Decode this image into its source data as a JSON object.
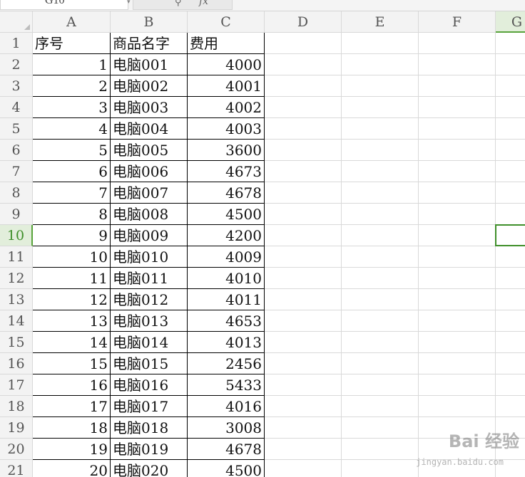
{
  "formula_bar": {
    "name_box": "G10",
    "zoom_icon": "magnifier-icon",
    "fx_label": "fx",
    "formula_value": ""
  },
  "sheet": {
    "selected_cell": "G10",
    "accent_color": "#58a33b",
    "columns": [
      "A",
      "B",
      "C",
      "D",
      "E",
      "F",
      "G"
    ],
    "rows": [
      {
        "n": "1",
        "a": "序号",
        "b": "商品名字",
        "c": "费用"
      },
      {
        "n": "2",
        "a": "1",
        "b": "电脑001",
        "c": "4000"
      },
      {
        "n": "3",
        "a": "2",
        "b": "电脑002",
        "c": "4001"
      },
      {
        "n": "4",
        "a": "3",
        "b": "电脑003",
        "c": "4002"
      },
      {
        "n": "5",
        "a": "4",
        "b": "电脑004",
        "c": "4003"
      },
      {
        "n": "6",
        "a": "5",
        "b": "电脑005",
        "c": "3600"
      },
      {
        "n": "7",
        "a": "6",
        "b": "电脑006",
        "c": "4673"
      },
      {
        "n": "8",
        "a": "7",
        "b": "电脑007",
        "c": "4678"
      },
      {
        "n": "9",
        "a": "8",
        "b": "电脑008",
        "c": "4500"
      },
      {
        "n": "10",
        "a": "9",
        "b": "电脑009",
        "c": "4200"
      },
      {
        "n": "11",
        "a": "10",
        "b": "电脑010",
        "c": "4009"
      },
      {
        "n": "12",
        "a": "11",
        "b": "电脑011",
        "c": "4010"
      },
      {
        "n": "13",
        "a": "12",
        "b": "电脑012",
        "c": "4011"
      },
      {
        "n": "14",
        "a": "13",
        "b": "电脑013",
        "c": "4653"
      },
      {
        "n": "15",
        "a": "14",
        "b": "电脑014",
        "c": "4013"
      },
      {
        "n": "16",
        "a": "15",
        "b": "电脑015",
        "c": "2456"
      },
      {
        "n": "17",
        "a": "16",
        "b": "电脑016",
        "c": "5433"
      },
      {
        "n": "18",
        "a": "17",
        "b": "电脑017",
        "c": "4016"
      },
      {
        "n": "19",
        "a": "18",
        "b": "电脑018",
        "c": "3008"
      },
      {
        "n": "20",
        "a": "19",
        "b": "电脑019",
        "c": "4678"
      },
      {
        "n": "21",
        "a": "20",
        "b": "电脑020",
        "c": "4500"
      }
    ]
  },
  "watermark": {
    "main": "Bai 经验",
    "sub": "jingyan.baidu.com"
  }
}
